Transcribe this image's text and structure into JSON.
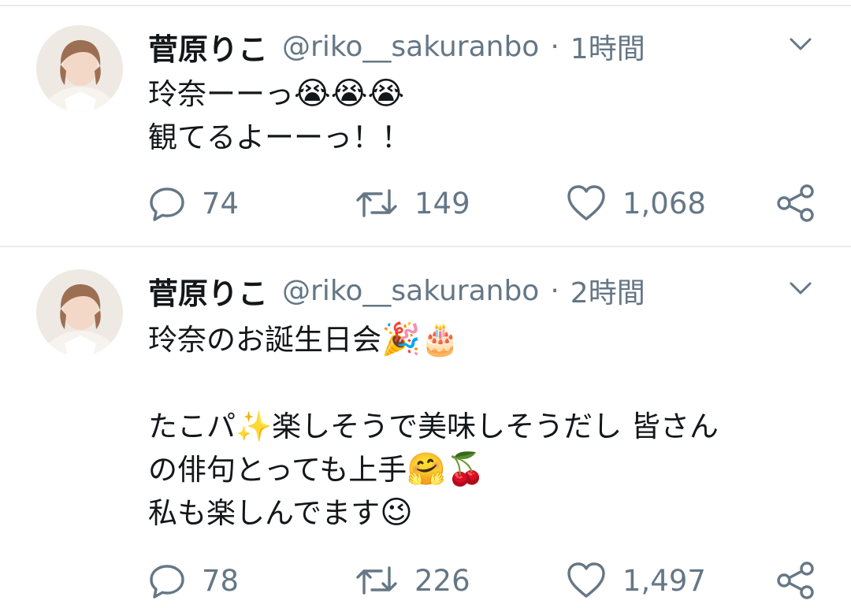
{
  "tweets": [
    {
      "name": "菅原りこ",
      "handle": "@riko__sakuranbo",
      "separator": "·",
      "time": "1時間",
      "lines": [
        {
          "text": "玲奈ーーっ",
          "emoji": "😭😭😭"
        },
        {
          "text": "観てるよーーっ！！",
          "emoji": ""
        }
      ],
      "actions": {
        "replies": "74",
        "retweets": "149",
        "likes": "1,068"
      }
    },
    {
      "name": "菅原りこ",
      "handle": "@riko__sakuranbo",
      "separator": "·",
      "time": "2時間",
      "lines": [
        {
          "text": "玲奈のお誕生日会",
          "emoji": "🎉🎂"
        },
        {
          "text": "",
          "emoji": ""
        },
        {
          "text": "たこパ✨楽しそうで美味しそうだし 皆さん",
          "emoji": ""
        },
        {
          "text": "の俳句とっても上手",
          "emoji": "🤗🍒"
        },
        {
          "text": "私も楽しんでます",
          "emoji": "😉"
        }
      ],
      "actions": {
        "replies": "78",
        "retweets": "226",
        "likes": "1,497"
      }
    }
  ],
  "icons": {
    "caret": "chevron-down-icon",
    "reply": "reply-icon",
    "retweet": "retweet-icon",
    "like": "heart-icon",
    "share": "share-icon"
  },
  "colors": {
    "text": "#14171a",
    "secondary": "#657786",
    "separator": "#e6ecf0"
  }
}
